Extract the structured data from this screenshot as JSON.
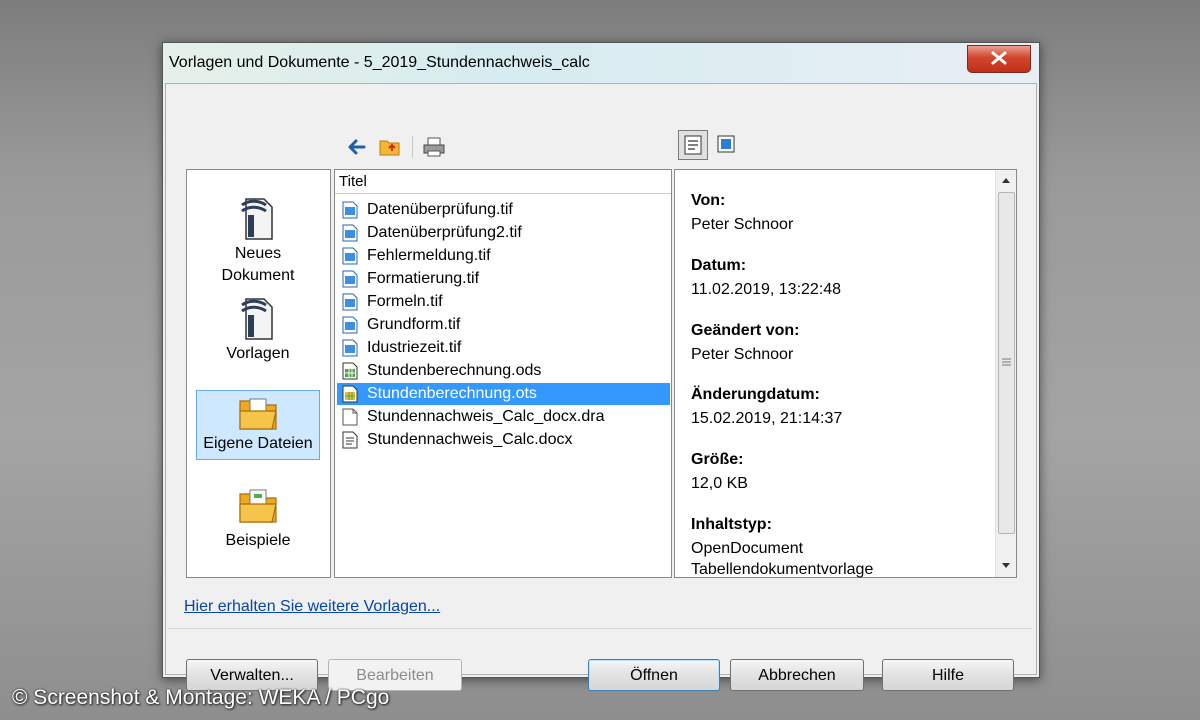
{
  "window": {
    "title": "Vorlagen und Dokumente - 5_2019_Stundennachweis_calc"
  },
  "toolbar": {
    "back_icon": "arrow-left-icon",
    "up_folder_icon": "folder-up-icon",
    "print_icon": "printer-icon",
    "view_details_icon": "document-view-icon",
    "view_preview_icon": "preview-icon"
  },
  "sidebar": {
    "items": [
      {
        "label_line1": "Neues",
        "label_line2": "Dokument",
        "icon": "new-document-icon"
      },
      {
        "label": "Vorlagen",
        "icon": "templates-icon"
      },
      {
        "label": "Eigene Dateien",
        "icon": "my-files-folder-icon",
        "selected": true
      },
      {
        "label": "Beispiele",
        "icon": "examples-folder-icon"
      }
    ]
  },
  "filelist": {
    "header": "Titel",
    "rows": [
      {
        "name": "Datenüberprüfung.tif",
        "icon": "image-file-icon"
      },
      {
        "name": "Datenüberprüfung2.tif",
        "icon": "image-file-icon"
      },
      {
        "name": "Fehlermeldung.tif",
        "icon": "image-file-icon"
      },
      {
        "name": "Formatierung.tif",
        "icon": "image-file-icon"
      },
      {
        "name": "Formeln.tif",
        "icon": "image-file-icon"
      },
      {
        "name": "Grundform.tif",
        "icon": "image-file-icon"
      },
      {
        "name": "Idustriezeit.tif",
        "icon": "image-file-icon"
      },
      {
        "name": "Stundenberechnung.ods",
        "icon": "spreadsheet-file-icon"
      },
      {
        "name": "Stundenberechnung.ots",
        "icon": "spreadsheet-template-icon",
        "selected": true
      },
      {
        "name": "Stundennachweis_Calc_docx.dra",
        "icon": "blank-file-icon"
      },
      {
        "name": "Stundennachweis_Calc.docx",
        "icon": "text-document-icon"
      }
    ]
  },
  "properties": {
    "von_label": "Von:",
    "von_value": "Peter Schnoor",
    "datum_label": "Datum:",
    "datum_value": "11.02.2019, 13:22:48",
    "geaendert_label": "Geändert von:",
    "geaendert_value": "Peter Schnoor",
    "aenderung_label": "Änderungdatum:",
    "aenderung_value": "15.02.2019, 21:14:37",
    "groesse_label": "Größe:",
    "groesse_value": "12,0 KB",
    "typ_label": "Inhaltstyp:",
    "typ_value_line1": "OpenDocument",
    "typ_value_line2": "Tabellendokumentvorlage"
  },
  "link": "Hier erhalten Sie weitere Vorlagen...",
  "buttons": {
    "manage": "Verwalten...",
    "edit": "Bearbeiten",
    "open": "Öffnen",
    "cancel": "Abbrechen",
    "help": "Hilfe"
  },
  "watermark": "© Screenshot & Montage: WEKA / PCgo",
  "colors": {
    "selection": "#3399ff",
    "link": "#0645ad",
    "close": "#c7402a"
  }
}
